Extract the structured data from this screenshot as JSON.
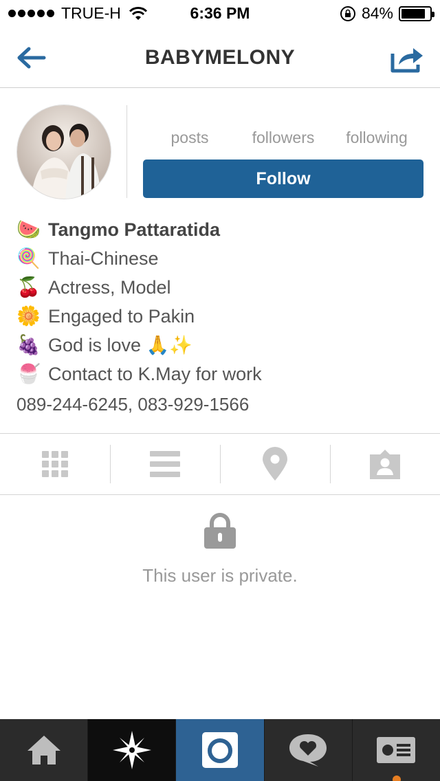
{
  "status_bar": {
    "carrier": "TRUE-H",
    "time": "6:36 PM",
    "battery": "84%",
    "battery_level": 0.84
  },
  "nav": {
    "title": "BABYMELONY",
    "back_icon": "back-arrow-icon",
    "share_icon": "share-icon"
  },
  "profile": {
    "stats": {
      "posts_label": "posts",
      "followers_label": "followers",
      "following_label": "following"
    },
    "follow_label": "Follow"
  },
  "bio": {
    "lines": [
      {
        "emoji": "🍉",
        "text": "Tangmo Pattaratida"
      },
      {
        "emoji": "🍭",
        "text": "Thai-Chinese"
      },
      {
        "emoji": "🍒",
        "text": "Actress, Model"
      },
      {
        "emoji": "🌼",
        "text": "Engaged to Pakin"
      },
      {
        "emoji": "🍇",
        "text": "God is love 🙏✨"
      },
      {
        "emoji": "🍧",
        "text": "Contact to K.May for work"
      }
    ],
    "phone": "089-244-6245, 083-929-1566"
  },
  "tabs": [
    "grid-icon",
    "list-icon",
    "location-pin-icon",
    "tagged-photos-icon"
  ],
  "private": {
    "message": "This user is private."
  },
  "bottom_bar": {
    "items": [
      "home-icon",
      "explore-icon",
      "camera-icon",
      "activity-icon",
      "profile-icon"
    ],
    "accent_color": "#2e6293"
  }
}
